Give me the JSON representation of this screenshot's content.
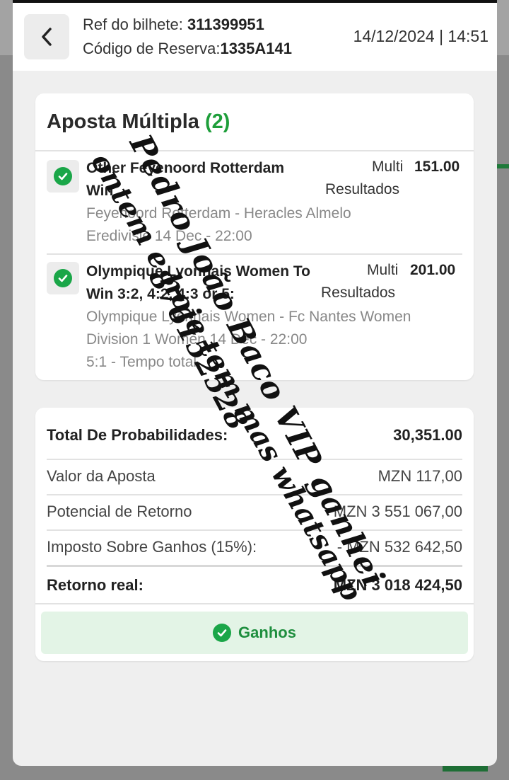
{
  "header": {
    "ref_label": "Ref do bilhete:",
    "ref_value": "311399951",
    "reservation_label": "Código de Reserva:",
    "reservation_value": "1335A141",
    "datetime": "14/12/2024 | 14:51"
  },
  "bet_card": {
    "title": "Aposta Múltipla",
    "count": "(2)",
    "selections": [
      {
        "selection_line1": "Other Feyenoord Rotterdam",
        "selection_line2": "Win",
        "market_line1": "Multi",
        "market_line2": "Resultados",
        "odds": "151.00",
        "match": "Feyenoord Rotterdam - Heracles Almelo",
        "league_time": "Eredivisie 14 Dec - 22:00",
        "status": "won"
      },
      {
        "selection_line1": "Olympique Lyonnais Women To",
        "selection_line2": "Win 3:2, 4:2, 4:3 or 5:",
        "market_line1": "Multi",
        "market_line2": "Resultados",
        "odds": "201.00",
        "match": "Olympique Lyonnais Women - Fc Nantes Women",
        "league_time": "Division 1 Women 14 Dec - 22:00",
        "extra": "5:1 - Tempo total",
        "status": "won"
      }
    ]
  },
  "summary": {
    "total_odds_label": "Total De Probabilidades:",
    "total_odds_value": "30,351.00",
    "stake_label": "Valor da Aposta",
    "stake_value": "MZN 117,00",
    "potential_label": "Potencial de Retorno",
    "potential_value": "MZN 3 551 067,00",
    "tax_label": "Imposto Sobre Ganhos (15%):",
    "tax_value": "- MZN 532 642,50",
    "real_return_label": "Retorno real:",
    "real_return_value": "MZN 3 018 424,50",
    "status_label": "Ganhos"
  },
  "handwriting": {
    "line1": "Pedro João Baco VIP ganhei",
    "line2": "ontem e hoje tem mas whatsapp",
    "line3": "876152528"
  },
  "icons": {
    "back": "chevron-left-icon",
    "check": "check-circle-icon"
  },
  "colors": {
    "accent_green": "#1aa648",
    "won_bg": "#e3f4e6",
    "count_green": "#1e9e3a"
  }
}
